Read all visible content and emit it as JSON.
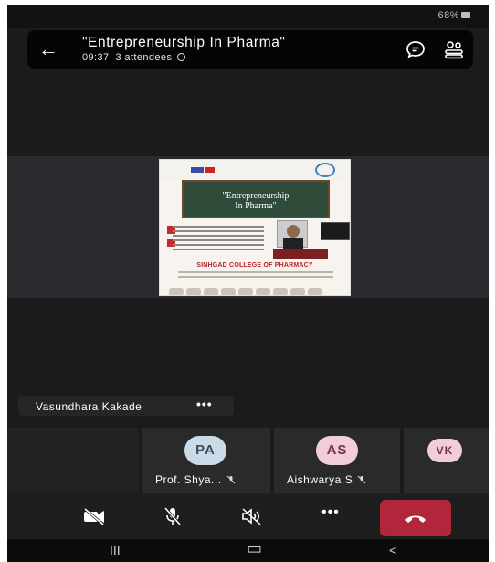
{
  "status_bar": {
    "battery_text": "68%"
  },
  "header": {
    "title": "\"Entrepreneurship  In Pharma\"",
    "duration": "09:37",
    "attendees": "3 attendees",
    "icons": [
      "back-arrow-icon",
      "chat-icon",
      "participants-icon"
    ]
  },
  "shared_content": {
    "board_line1": "\"Entrepreneurship",
    "board_line2": "In Pharma\"",
    "college": "SINHGAD COLLEGE OF PHARMACY"
  },
  "presenter": {
    "name": "Vasundhara Kakade",
    "more": "•••"
  },
  "participants": [
    {
      "initials": "PA",
      "name": "Prof. Shya...",
      "avatar_color": "#c9dbe7",
      "text_color": "#3e4b58"
    },
    {
      "initials": "AS",
      "name": "Aishwarya S",
      "avatar_color": "#f1cddc",
      "text_color": "#7a2f4a"
    },
    {
      "initials": "VK",
      "name": "",
      "avatar_color": "#f1cddc",
      "text_color": "#7a2f4a"
    }
  ],
  "toolbar": {
    "more_label": "•••",
    "icons": [
      "camera-off-icon",
      "mic-off-icon",
      "speaker-off-icon",
      "more-icon",
      "hang-up-icon"
    ],
    "hangup_color": "#b2263c"
  },
  "navbar": {
    "recent_glyph": "III",
    "home_glyph": "▭",
    "back_glyph": "<"
  }
}
